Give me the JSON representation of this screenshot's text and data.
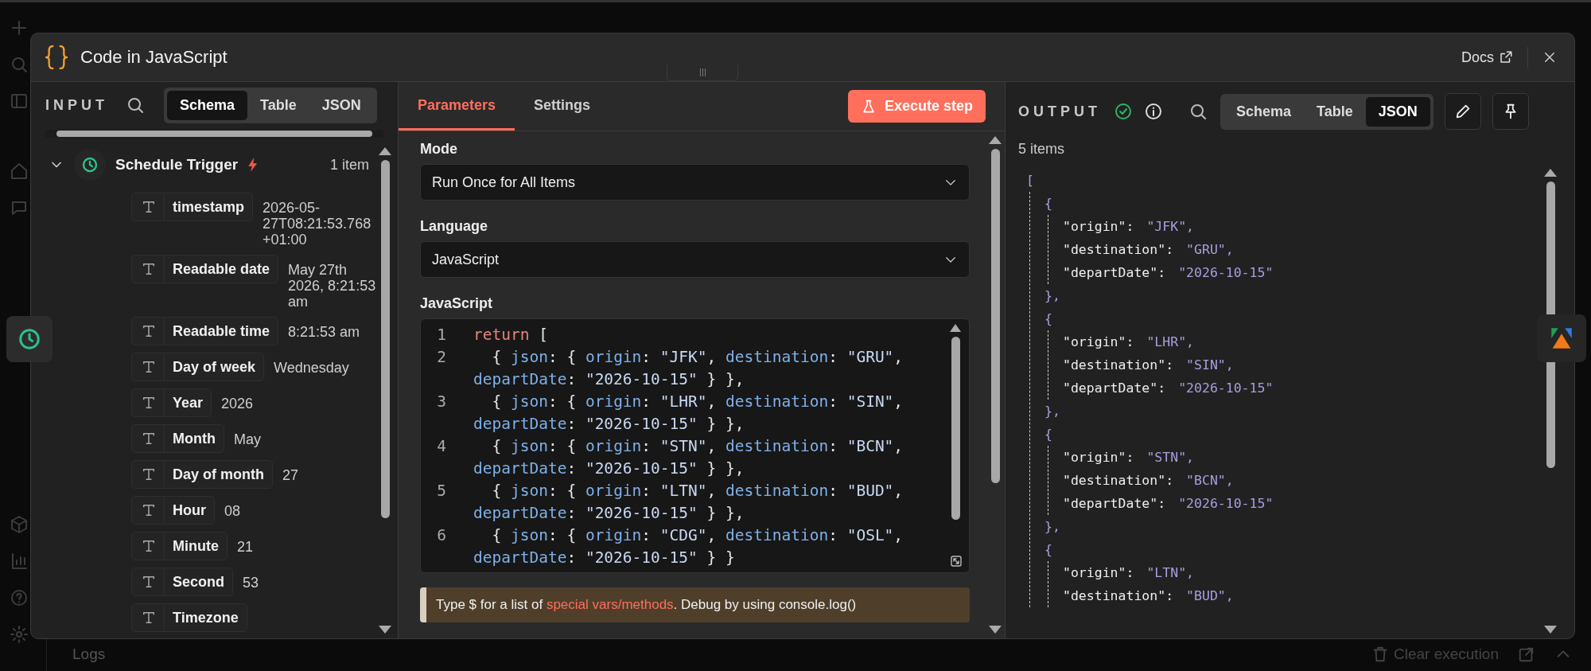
{
  "window": {
    "title": "Code in JavaScript",
    "docs_link": "Docs"
  },
  "input": {
    "title": "INPUT",
    "view_tabs": [
      {
        "label": "Schema",
        "selected": true
      },
      {
        "label": "Table",
        "selected": false
      },
      {
        "label": "JSON",
        "selected": false
      }
    ],
    "node": {
      "name": "Schedule Trigger",
      "expanded": true,
      "count": "1 item",
      "fields": [
        {
          "key": "timestamp",
          "value": "2026-05-27T08:21:53.768+01:00"
        },
        {
          "key": "Readable date",
          "value": "May 27th 2026, 8:21:53 am"
        },
        {
          "key": "Readable time",
          "value": "8:21:53 am"
        },
        {
          "key": "Day of week",
          "value": "Wednesday"
        },
        {
          "key": "Year",
          "value": "2026"
        },
        {
          "key": "Month",
          "value": "May"
        },
        {
          "key": "Day of month",
          "value": "27"
        },
        {
          "key": "Hour",
          "value": "08"
        },
        {
          "key": "Minute",
          "value": "21"
        },
        {
          "key": "Second",
          "value": "53"
        },
        {
          "key": "Timezone"
        }
      ]
    }
  },
  "parameters": {
    "tabs": [
      {
        "label": "Parameters",
        "selected": true
      },
      {
        "label": "Settings",
        "selected": false
      }
    ],
    "execute_button": "Execute step",
    "mode": {
      "label": "Mode",
      "value": "Run Once for All Items"
    },
    "language": {
      "label": "Language",
      "value": "JavaScript"
    },
    "code": {
      "label": "JavaScript",
      "lines": [
        {
          "number": "1",
          "tokens": [
            {
              "kind": "keyword",
              "text": "return"
            },
            {
              "kind": "punct",
              "text": " ["
            }
          ]
        },
        {
          "number": "2",
          "tokens": [
            {
              "kind": "punct",
              "text": "  { "
            },
            {
              "kind": "prop",
              "text": "json"
            },
            {
              "kind": "punct",
              "text": ": { "
            },
            {
              "kind": "prop",
              "text": "origin"
            },
            {
              "kind": "punct",
              "text": ": "
            },
            {
              "kind": "string",
              "text": "\"JFK\""
            },
            {
              "kind": "punct",
              "text": ", "
            },
            {
              "kind": "prop",
              "text": "destination"
            },
            {
              "kind": "punct",
              "text": ": "
            },
            {
              "kind": "string",
              "text": "\"GRU\""
            },
            {
              "kind": "punct",
              "text": ", "
            },
            {
              "kind": "prop",
              "text": "departDate"
            },
            {
              "kind": "punct",
              "text": ": "
            },
            {
              "kind": "string",
              "text": "\"2026-10-15\""
            },
            {
              "kind": "punct",
              "text": " } },"
            }
          ]
        },
        {
          "number": "3",
          "tokens": [
            {
              "kind": "punct",
              "text": "  { "
            },
            {
              "kind": "prop",
              "text": "json"
            },
            {
              "kind": "punct",
              "text": ": { "
            },
            {
              "kind": "prop",
              "text": "origin"
            },
            {
              "kind": "punct",
              "text": ": "
            },
            {
              "kind": "string",
              "text": "\"LHR\""
            },
            {
              "kind": "punct",
              "text": ", "
            },
            {
              "kind": "prop",
              "text": "destination"
            },
            {
              "kind": "punct",
              "text": ": "
            },
            {
              "kind": "string",
              "text": "\"SIN\""
            },
            {
              "kind": "punct",
              "text": ", "
            },
            {
              "kind": "prop",
              "text": "departDate"
            },
            {
              "kind": "punct",
              "text": ": "
            },
            {
              "kind": "string",
              "text": "\"2026-10-15\""
            },
            {
              "kind": "punct",
              "text": " } },"
            }
          ]
        },
        {
          "number": "4",
          "tokens": [
            {
              "kind": "punct",
              "text": "  { "
            },
            {
              "kind": "prop",
              "text": "json"
            },
            {
              "kind": "punct",
              "text": ": { "
            },
            {
              "kind": "prop",
              "text": "origin"
            },
            {
              "kind": "punct",
              "text": ": "
            },
            {
              "kind": "string",
              "text": "\"STN\""
            },
            {
              "kind": "punct",
              "text": ", "
            },
            {
              "kind": "prop",
              "text": "destination"
            },
            {
              "kind": "punct",
              "text": ": "
            },
            {
              "kind": "string",
              "text": "\"BCN\""
            },
            {
              "kind": "punct",
              "text": ", "
            },
            {
              "kind": "prop",
              "text": "departDate"
            },
            {
              "kind": "punct",
              "text": ": "
            },
            {
              "kind": "string",
              "text": "\"2026-10-15\""
            },
            {
              "kind": "punct",
              "text": " } },"
            }
          ]
        },
        {
          "number": "5",
          "tokens": [
            {
              "kind": "punct",
              "text": "  { "
            },
            {
              "kind": "prop",
              "text": "json"
            },
            {
              "kind": "punct",
              "text": ": { "
            },
            {
              "kind": "prop",
              "text": "origin"
            },
            {
              "kind": "punct",
              "text": ": "
            },
            {
              "kind": "string",
              "text": "\"LTN\""
            },
            {
              "kind": "punct",
              "text": ", "
            },
            {
              "kind": "prop",
              "text": "destination"
            },
            {
              "kind": "punct",
              "text": ": "
            },
            {
              "kind": "string",
              "text": "\"BUD\""
            },
            {
              "kind": "punct",
              "text": ", "
            },
            {
              "kind": "prop",
              "text": "departDate"
            },
            {
              "kind": "punct",
              "text": ": "
            },
            {
              "kind": "string",
              "text": "\"2026-10-15\""
            },
            {
              "kind": "punct",
              "text": " } },"
            }
          ]
        },
        {
          "number": "6",
          "tokens": [
            {
              "kind": "punct",
              "text": "  { "
            },
            {
              "kind": "prop",
              "text": "json"
            },
            {
              "kind": "punct",
              "text": ": { "
            },
            {
              "kind": "prop",
              "text": "origin"
            },
            {
              "kind": "punct",
              "text": ": "
            },
            {
              "kind": "string",
              "text": "\"CDG\""
            },
            {
              "kind": "punct",
              "text": ", "
            },
            {
              "kind": "prop",
              "text": "destination"
            },
            {
              "kind": "punct",
              "text": ": "
            },
            {
              "kind": "string",
              "text": "\"OSL\""
            },
            {
              "kind": "punct",
              "text": ", "
            },
            {
              "kind": "prop",
              "text": "departDate"
            },
            {
              "kind": "punct",
              "text": ": "
            },
            {
              "kind": "string",
              "text": "\"2026-10-15\""
            },
            {
              "kind": "punct",
              "text": " } }"
            }
          ]
        }
      ]
    },
    "hint": {
      "before": "Type $ for a list of ",
      "link": "special vars/methods",
      "after": ". Debug by using console.log()"
    }
  },
  "output": {
    "title": "OUTPUT",
    "success": true,
    "view_tabs": [
      {
        "label": "Schema",
        "selected": false
      },
      {
        "label": "Table",
        "selected": false
      },
      {
        "label": "JSON",
        "selected": true
      }
    ],
    "count": "5 items",
    "json": {
      "open": "[",
      "items": [
        {
          "open": "{",
          "fields": [
            {
              "key": "\"origin\":",
              "value": "\"JFK\","
            },
            {
              "key": "\"destination\":",
              "value": "\"GRU\","
            },
            {
              "key": "\"departDate\":",
              "value": "\"2026-10-15\""
            }
          ],
          "close": "},"
        },
        {
          "open": "{",
          "fields": [
            {
              "key": "\"origin\":",
              "value": "\"LHR\","
            },
            {
              "key": "\"destination\":",
              "value": "\"SIN\","
            },
            {
              "key": "\"departDate\":",
              "value": "\"2026-10-15\""
            }
          ],
          "close": "},"
        },
        {
          "open": "{",
          "fields": [
            {
              "key": "\"origin\":",
              "value": "\"STN\","
            },
            {
              "key": "\"destination\":",
              "value": "\"BCN\","
            },
            {
              "key": "\"departDate\":",
              "value": "\"2026-10-15\""
            }
          ],
          "close": "},"
        },
        {
          "open": "{",
          "fields": [
            {
              "key": "\"origin\":",
              "value": "\"LTN\","
            },
            {
              "key": "\"destination\":",
              "value": "\"BUD\","
            }
          ]
        }
      ]
    }
  },
  "logs": {
    "title": "Logs",
    "clear_button": "Clear execution"
  }
}
